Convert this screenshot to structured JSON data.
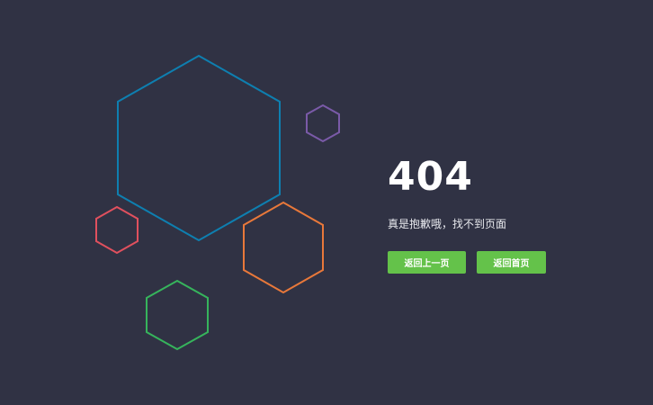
{
  "error": {
    "code": "404",
    "message": "真是抱歉哦，找不到页面"
  },
  "actions": {
    "back_label": "返回上一页",
    "home_label": "返回首页"
  },
  "decorations": {
    "hexagons": [
      {
        "name": "large-blue-hexagon",
        "color": "#0e7fb0"
      },
      {
        "name": "small-purple-hexagon",
        "color": "#7a5aa8"
      },
      {
        "name": "small-red-hexagon",
        "color": "#e0505e"
      },
      {
        "name": "orange-hexagon",
        "color": "#e8783a"
      },
      {
        "name": "green-hexagon",
        "color": "#36b45c"
      }
    ]
  },
  "colors": {
    "background": "#303244",
    "button": "#64c24a",
    "text": "#ffffff"
  }
}
